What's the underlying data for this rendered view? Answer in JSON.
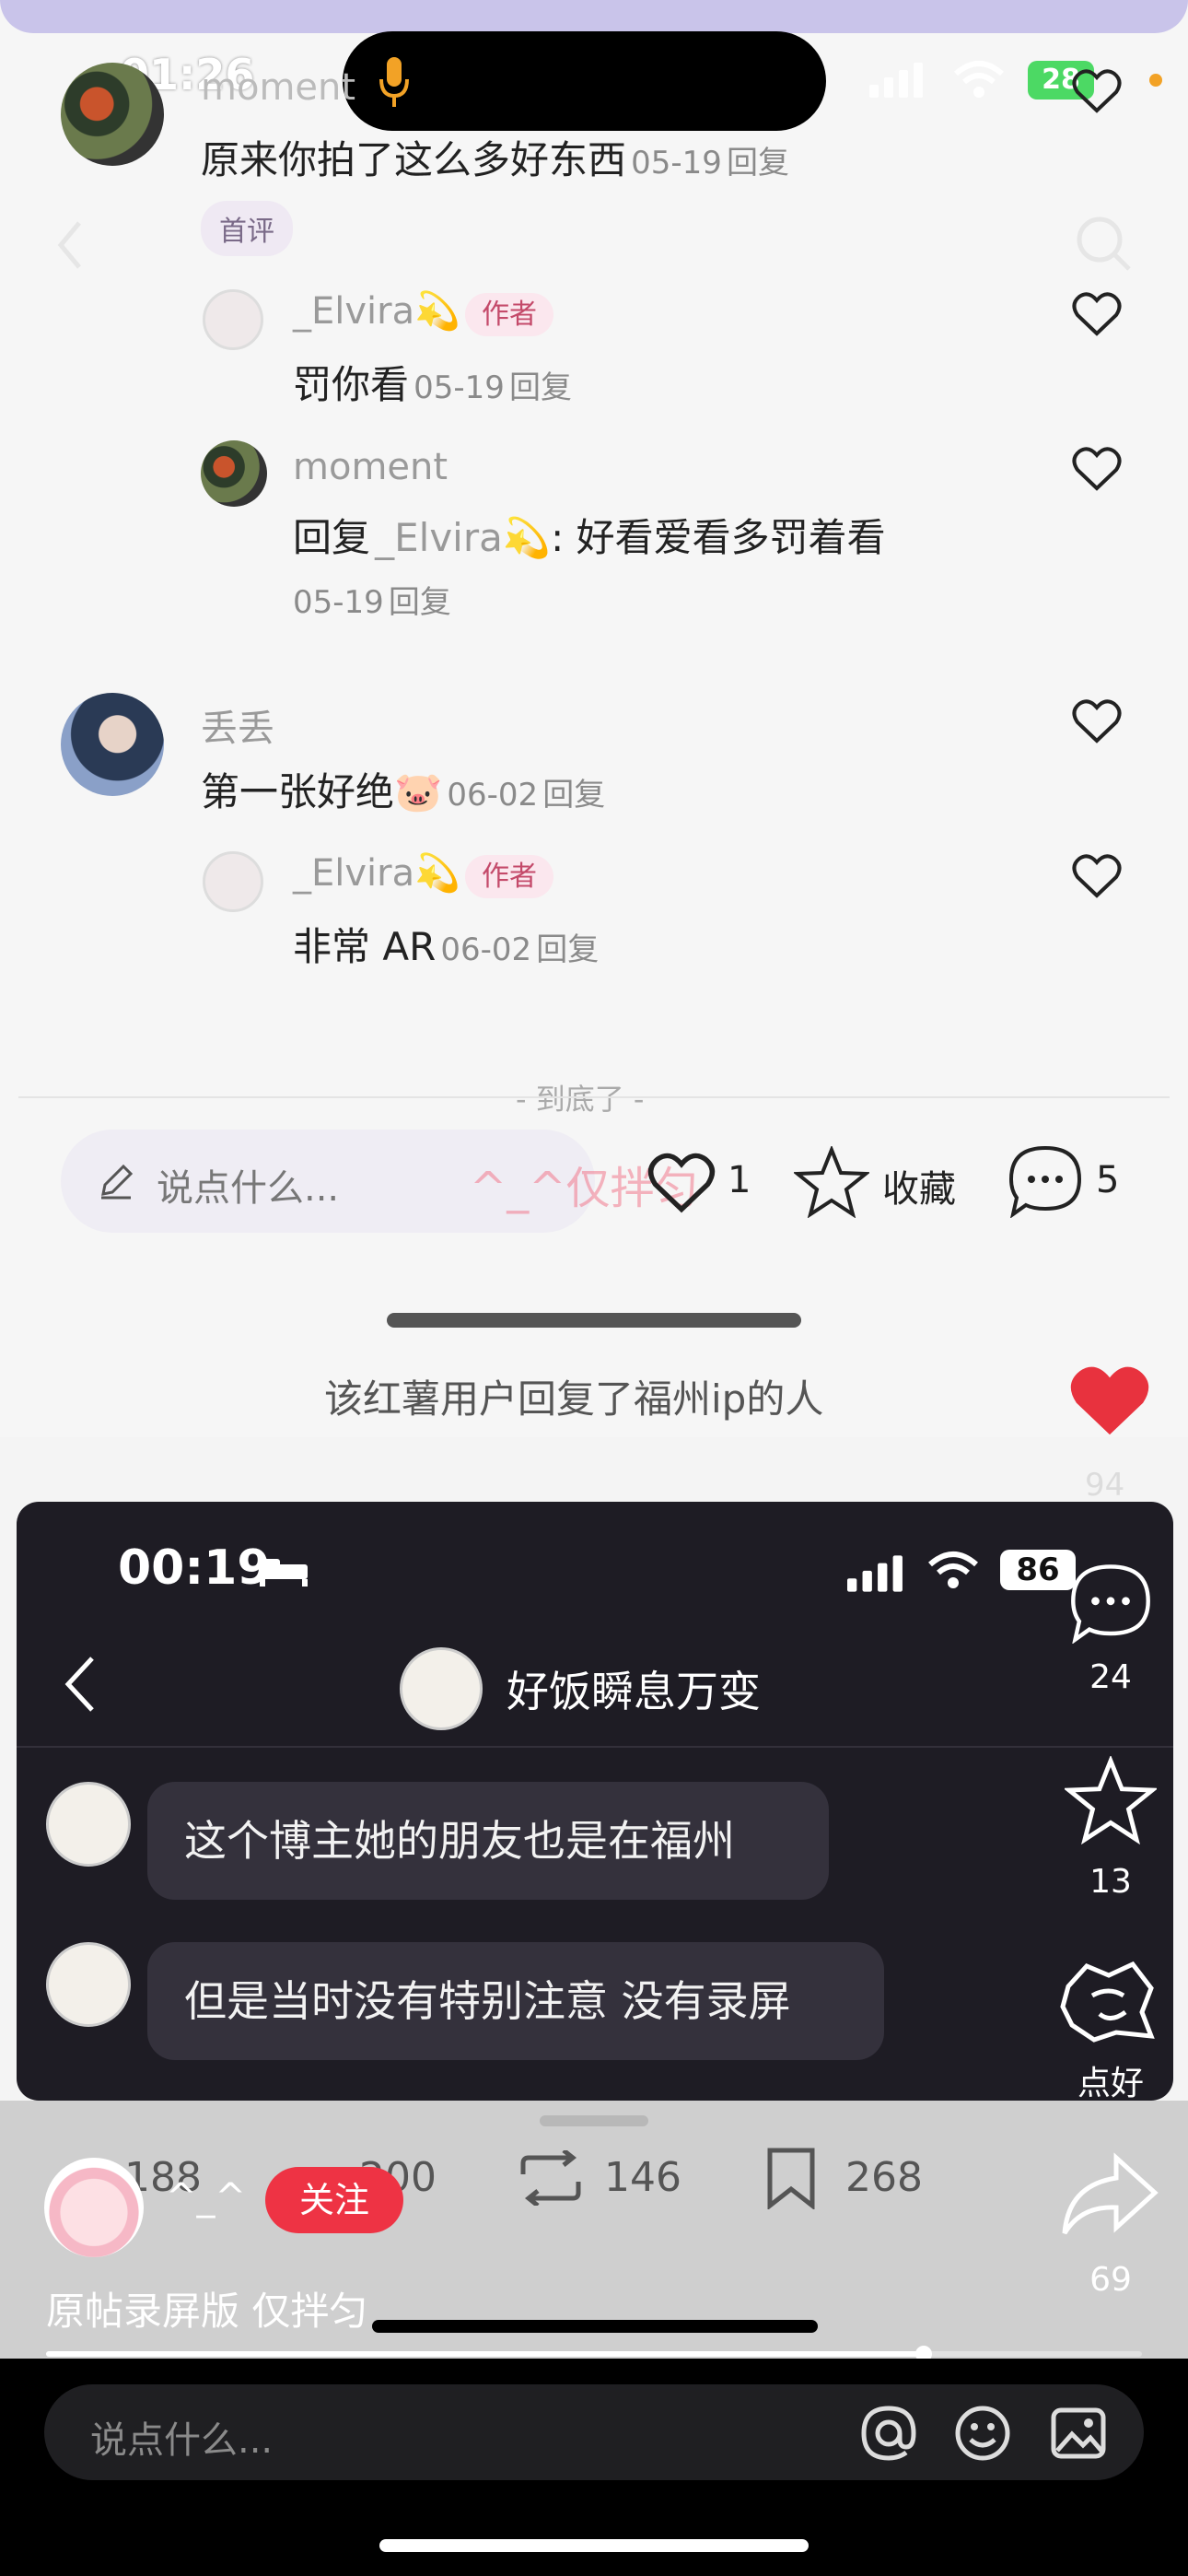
{
  "status_top": {
    "time": "01:26",
    "battery": "28"
  },
  "comments": {
    "c1": {
      "name": "moment",
      "text": "原来你拍了这么多好东西",
      "date": "05-19",
      "reply": "回复",
      "tag": "首评"
    },
    "r1": {
      "name": "_Elvira💫",
      "tag": "作者",
      "text": "罚你看",
      "date": "05-19",
      "reply": "回复"
    },
    "r2": {
      "name": "moment",
      "prefix": "回复",
      "mention": "_Elvira💫",
      "text": ": 好看爱看多罚着看",
      "date": "05-19",
      "reply": "回复"
    },
    "c2": {
      "name": "丢丢",
      "text": "第一张好绝🐷",
      "date": "06-02",
      "reply": "回复"
    },
    "r3": {
      "name": "_Elvira💫",
      "tag": "作者",
      "text": "非常 AR",
      "date": "06-02",
      "reply": "回复"
    },
    "end": "- 到底了 -"
  },
  "action_bar": {
    "placeholder": "说点什么...",
    "watermark": "^_^仅拌匀",
    "likes": "1",
    "collect": "收藏",
    "comments": "5"
  },
  "caption": "该红薯用户回复了福州ip的人",
  "chat": {
    "time": "00:19",
    "battery": "86",
    "title": "好饭瞬息万变",
    "messages": [
      "这个博主她的朋友也是在福州",
      "但是当时没有特别注意 没有录屏"
    ]
  },
  "faded_stats": {
    "s1": "188",
    "s2": "200",
    "s3": "146",
    "s4": "268"
  },
  "video_side": {
    "like_count": "94",
    "comment_count": "24",
    "star_count": "13",
    "rate_label": "点好",
    "share_count": "69"
  },
  "video_author": {
    "name": "^_^",
    "follow": "关注",
    "desc": "原帖录屏版 仅拌匀",
    "progress": 0.8
  },
  "bottom_input": {
    "placeholder": "说点什么..."
  },
  "colors": {
    "accent_red": "#ee3344",
    "heart_red": "#e8323e",
    "author_tag": "#c44a6a"
  }
}
